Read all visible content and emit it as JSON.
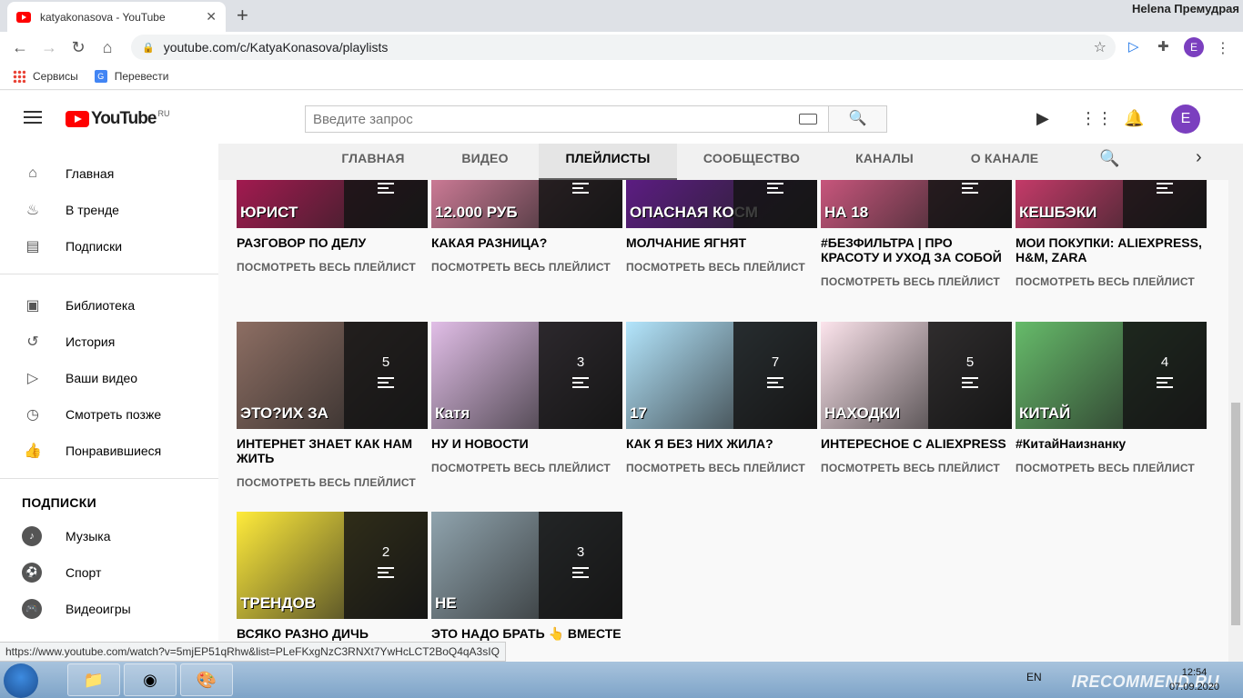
{
  "browser": {
    "tab_title": "katyakonasova - YouTube",
    "profile_name": "Helena Премудрая",
    "url": "youtube.com/c/KatyaKonasova/playlists",
    "profile_initial": "E",
    "bookmarks": [
      "Сервисы",
      "Перевести"
    ]
  },
  "header": {
    "logo_text": "YouTube",
    "logo_country": "RU",
    "search_placeholder": "Введите запрос",
    "avatar_initial": "E"
  },
  "sidebar": {
    "main": [
      {
        "label": "Главная",
        "icon": "home-icon"
      },
      {
        "label": "В тренде",
        "icon": "fire-icon"
      },
      {
        "label": "Подписки",
        "icon": "subscriptions-icon"
      }
    ],
    "library": [
      {
        "label": "Библиотека",
        "icon": "library-icon"
      },
      {
        "label": "История",
        "icon": "history-icon"
      },
      {
        "label": "Ваши видео",
        "icon": "your-videos-icon"
      },
      {
        "label": "Смотреть позже",
        "icon": "clock-icon"
      },
      {
        "label": "Понравившиеся",
        "icon": "thumbs-up-icon"
      }
    ],
    "subscriptions_heading": "ПОДПИСКИ",
    "subscriptions": [
      {
        "label": "Музыка",
        "icon": "music-icon"
      },
      {
        "label": "Спорт",
        "icon": "sport-icon"
      },
      {
        "label": "Видеоигры",
        "icon": "gaming-icon"
      }
    ]
  },
  "channel_tabs": [
    "ГЛАВНАЯ",
    "ВИДЕО",
    "ПЛЕЙЛИСТЫ",
    "СООБЩЕСТВО",
    "КАНАЛЫ",
    "О КАНАЛЕ"
  ],
  "active_tab": "ПЛЕЙЛИСТЫ",
  "view_all_label": "ПОСМОТРЕТЬ ВЕСЬ ПЛЕЙЛИСТ",
  "playlists": [
    {
      "title": "РАЗГОВОР ПО ДЕЛУ",
      "count": "",
      "caption": "ЮРИСТ",
      "color": "#c2185b"
    },
    {
      "title": "КАКАЯ РАЗНИЦА?",
      "count": "",
      "caption": "12.000 РУБ",
      "color": "#f48fb1"
    },
    {
      "title": "МОЛЧАНИЕ ЯГНЯТ",
      "count": "",
      "caption": "ОПАСНАЯ КОСМ",
      "color": "#6a1b9a"
    },
    {
      "title": "#БЕЗФИЛЬТРА | ПРО КРАСОТУ И УХОД ЗА СОБОЙ",
      "count": "",
      "caption": "НА 18",
      "color": "#f06292"
    },
    {
      "title": "МОИ ПОКУПКИ: ALIEXPRESS, H&M, ZARA",
      "count": "",
      "caption": "КЕШБЭКИ",
      "color": "#ec407a"
    },
    {
      "title": "ИНТЕРНЕТ ЗНАЕТ КАК НАМ ЖИТЬ",
      "count": "5",
      "caption": "ЭТО?ИХ ЗА",
      "color": "#8d6e63"
    },
    {
      "title": "НУ И НОВОСТИ",
      "count": "3",
      "caption": "Катя",
      "color": "#e1bee7"
    },
    {
      "title": "КАК Я БЕЗ НИХ ЖИЛА?",
      "count": "7",
      "caption": "17",
      "color": "#b3e5fc"
    },
    {
      "title": "ИНТЕРЕСНОЕ С ALIEXPRESS",
      "count": "5",
      "caption": "НАХОДКИ",
      "color": "#fce4ec"
    },
    {
      "title": "#КитайНаизнанку",
      "count": "4",
      "caption": "КИТАЙ",
      "color": "#66bb6a"
    },
    {
      "title": "ВСЯКО РАЗНО ДИЧЬ",
      "count": "2",
      "caption": "ТРЕНДОВ",
      "color": "#ffeb3b"
    },
    {
      "title": "ЭТО НАДО БРАТЬ 👆 ВМЕСТЕ С",
      "count": "3",
      "caption": "НЕ",
      "color": "#90a4ae"
    }
  ],
  "status_url": "https://www.youtube.com/watch?v=5mjEP51qRhw&list=PLeFKxgNzC3RNXt7YwHcLCT2BoQ4qA3sIQ",
  "taskbar": {
    "lang": "EN",
    "time": "12:54",
    "date": "07.09.2020",
    "watermark": "IRECOMMEND.RU"
  }
}
